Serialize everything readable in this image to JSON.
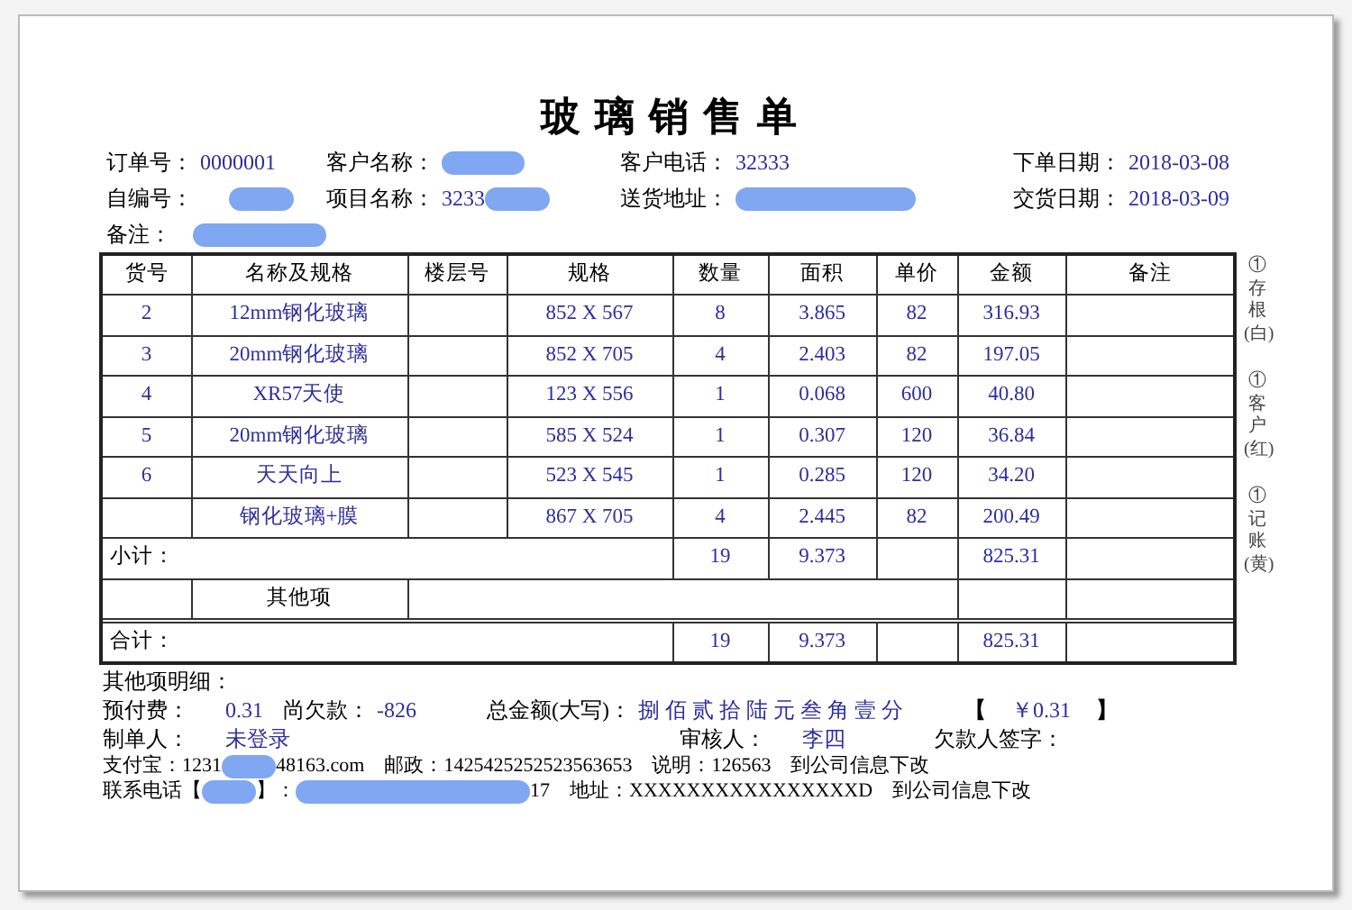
{
  "title": "玻璃销售单",
  "header_rows": [
    [
      {
        "label": "订单号：",
        "value": "0000001",
        "redacted": false
      },
      {
        "label": "客户名称：",
        "redacted": true
      },
      {
        "label": "客户电话：",
        "value": "32333",
        "redacted": false
      },
      {
        "label": "下单日期：",
        "value": "2018-03-08",
        "redacted": false
      }
    ],
    [
      {
        "label": "自编号：",
        "redacted": true
      },
      {
        "label": "项目名称：",
        "value": "3233",
        "redacted": true
      },
      {
        "label": "送货地址：",
        "redacted": true
      },
      {
        "label": "交货日期：",
        "value": "2018-03-09",
        "redacted": false
      }
    ],
    [
      {
        "label": "备注：",
        "redacted": true
      }
    ]
  ],
  "table": {
    "columns": [
      "货号",
      "名称及规格",
      "楼层号",
      "规格",
      "数量",
      "面积",
      "单价",
      "金额",
      "备注"
    ],
    "rows": [
      [
        "2",
        "12mm钢化玻璃",
        null,
        "852 X 567",
        "8",
        "3.865",
        "82",
        "316.93",
        null
      ],
      [
        "3",
        "20mm钢化玻璃",
        null,
        "852 X 705",
        "4",
        "2.403",
        "82",
        "197.05",
        null
      ],
      [
        "4",
        "XR57天使",
        null,
        "123 X 556",
        "1",
        "0.068",
        "600",
        "40.80",
        null
      ],
      [
        "5",
        "20mm钢化玻璃",
        null,
        "585 X 524",
        "1",
        "0.307",
        "120",
        "36.84",
        null
      ],
      [
        "6",
        "天天向上",
        null,
        "523 X 545",
        "1",
        "0.285",
        "120",
        "34.20",
        null
      ],
      [
        null,
        "钢化玻璃+膜",
        null,
        "867 X 705",
        "4",
        "2.445",
        "82",
        "200.49",
        null
      ]
    ],
    "subtotal": {
      "label": "小计：",
      "qty": "19",
      "area": "9.373",
      "amount": "825.31"
    },
    "other_items": {
      "label": "其他项"
    },
    "total": {
      "label": "合计：",
      "qty": "19",
      "area": "9.373",
      "amount": "825.31"
    }
  },
  "side_notes": [
    "①存根(白)",
    "①客户(红)",
    "①记账(黄)"
  ],
  "other_details_label": "其他项明细：",
  "payment": [
    {
      "label": "预付费：",
      "value": "0.31"
    },
    {
      "label": "尚欠款：",
      "value": "-826"
    },
    {
      "label": "总金额(大写)：",
      "value": "捌 佰 贰 拾 陆 元 叁 角 壹 分"
    }
  ],
  "amount_box": {
    "open": "【",
    "value": "￥0.31",
    "close": "】"
  },
  "signatures": [
    {
      "label": "制单人：",
      "value": "未登录"
    },
    {
      "label": "审核人：",
      "value": "李四"
    },
    {
      "label": "欠款人签字："
    }
  ],
  "info_lines": [
    [
      {
        "kind": "text",
        "text": "支付宝：1231"
      },
      {
        "kind": "redacted"
      },
      {
        "kind": "text",
        "text": "48163.com　邮政：1425425252523563653　说明：126563　到公司信息下改"
      }
    ],
    [
      {
        "kind": "text",
        "text": "联系电话【"
      },
      {
        "kind": "redacted"
      },
      {
        "kind": "text",
        "text": "】："
      },
      {
        "kind": "long_redacted"
      },
      {
        "kind": "text",
        "text": "17　地址：XXXXXXXXXXXXXXXXD　到公司信息下改"
      }
    ]
  ]
}
